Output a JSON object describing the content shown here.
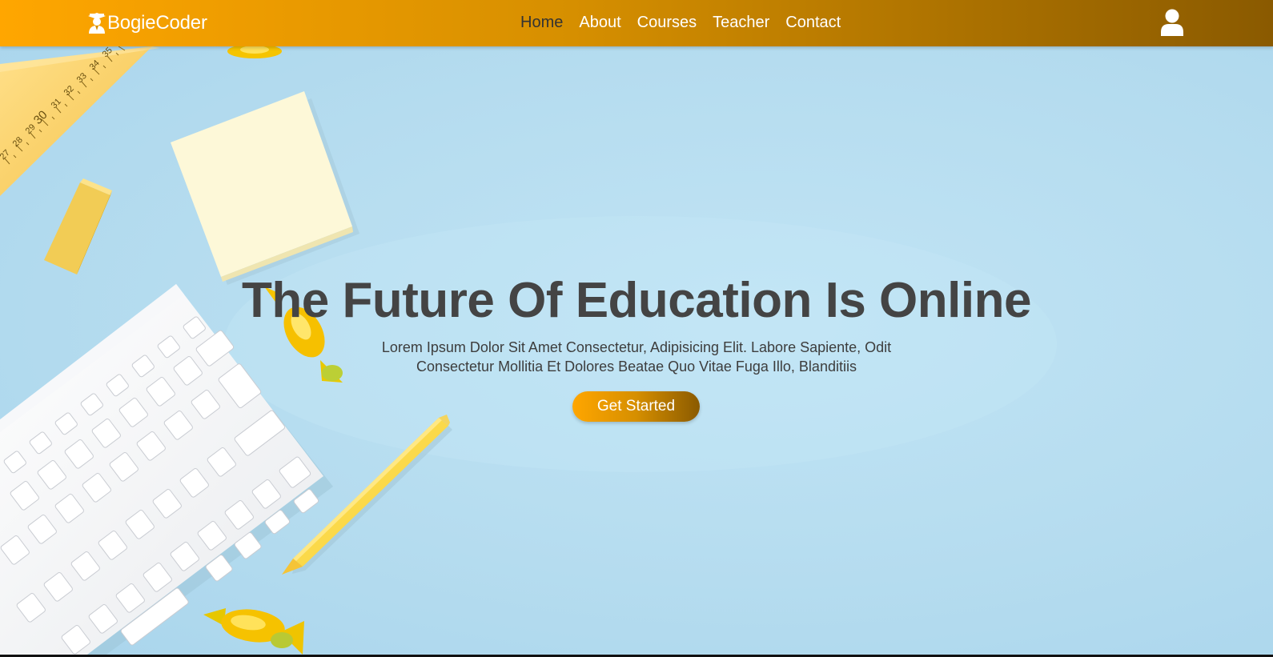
{
  "brand": {
    "name": "BogieCoder",
    "icon": "graduate-icon"
  },
  "nav": {
    "items": [
      {
        "label": "Home",
        "active": true
      },
      {
        "label": "About"
      },
      {
        "label": "Courses"
      },
      {
        "label": "Teacher"
      },
      {
        "label": "Contact"
      }
    ],
    "user_icon": "user-icon"
  },
  "hero": {
    "title": "The Future Of Education Is Online",
    "description_line1": "Lorem Ipsum Dolor Sit Amet Consectetur, Adipisicing Elit. Labore Sapiente, Odit",
    "description_line2": "Consectetur Mollitia Et Dolores Beatae Quo Vitae Fuga Illo, Blanditiis",
    "cta_label": "Get Started"
  },
  "ruler": {
    "numbers": [
      "27",
      "28",
      "29",
      "30",
      "31",
      "32",
      "33",
      "34",
      "35"
    ]
  },
  "colors": {
    "accent_start": "#ffa600",
    "accent_end": "#8a5a00",
    "hero_background": "#b6ddf0",
    "title_text": "#444444"
  }
}
